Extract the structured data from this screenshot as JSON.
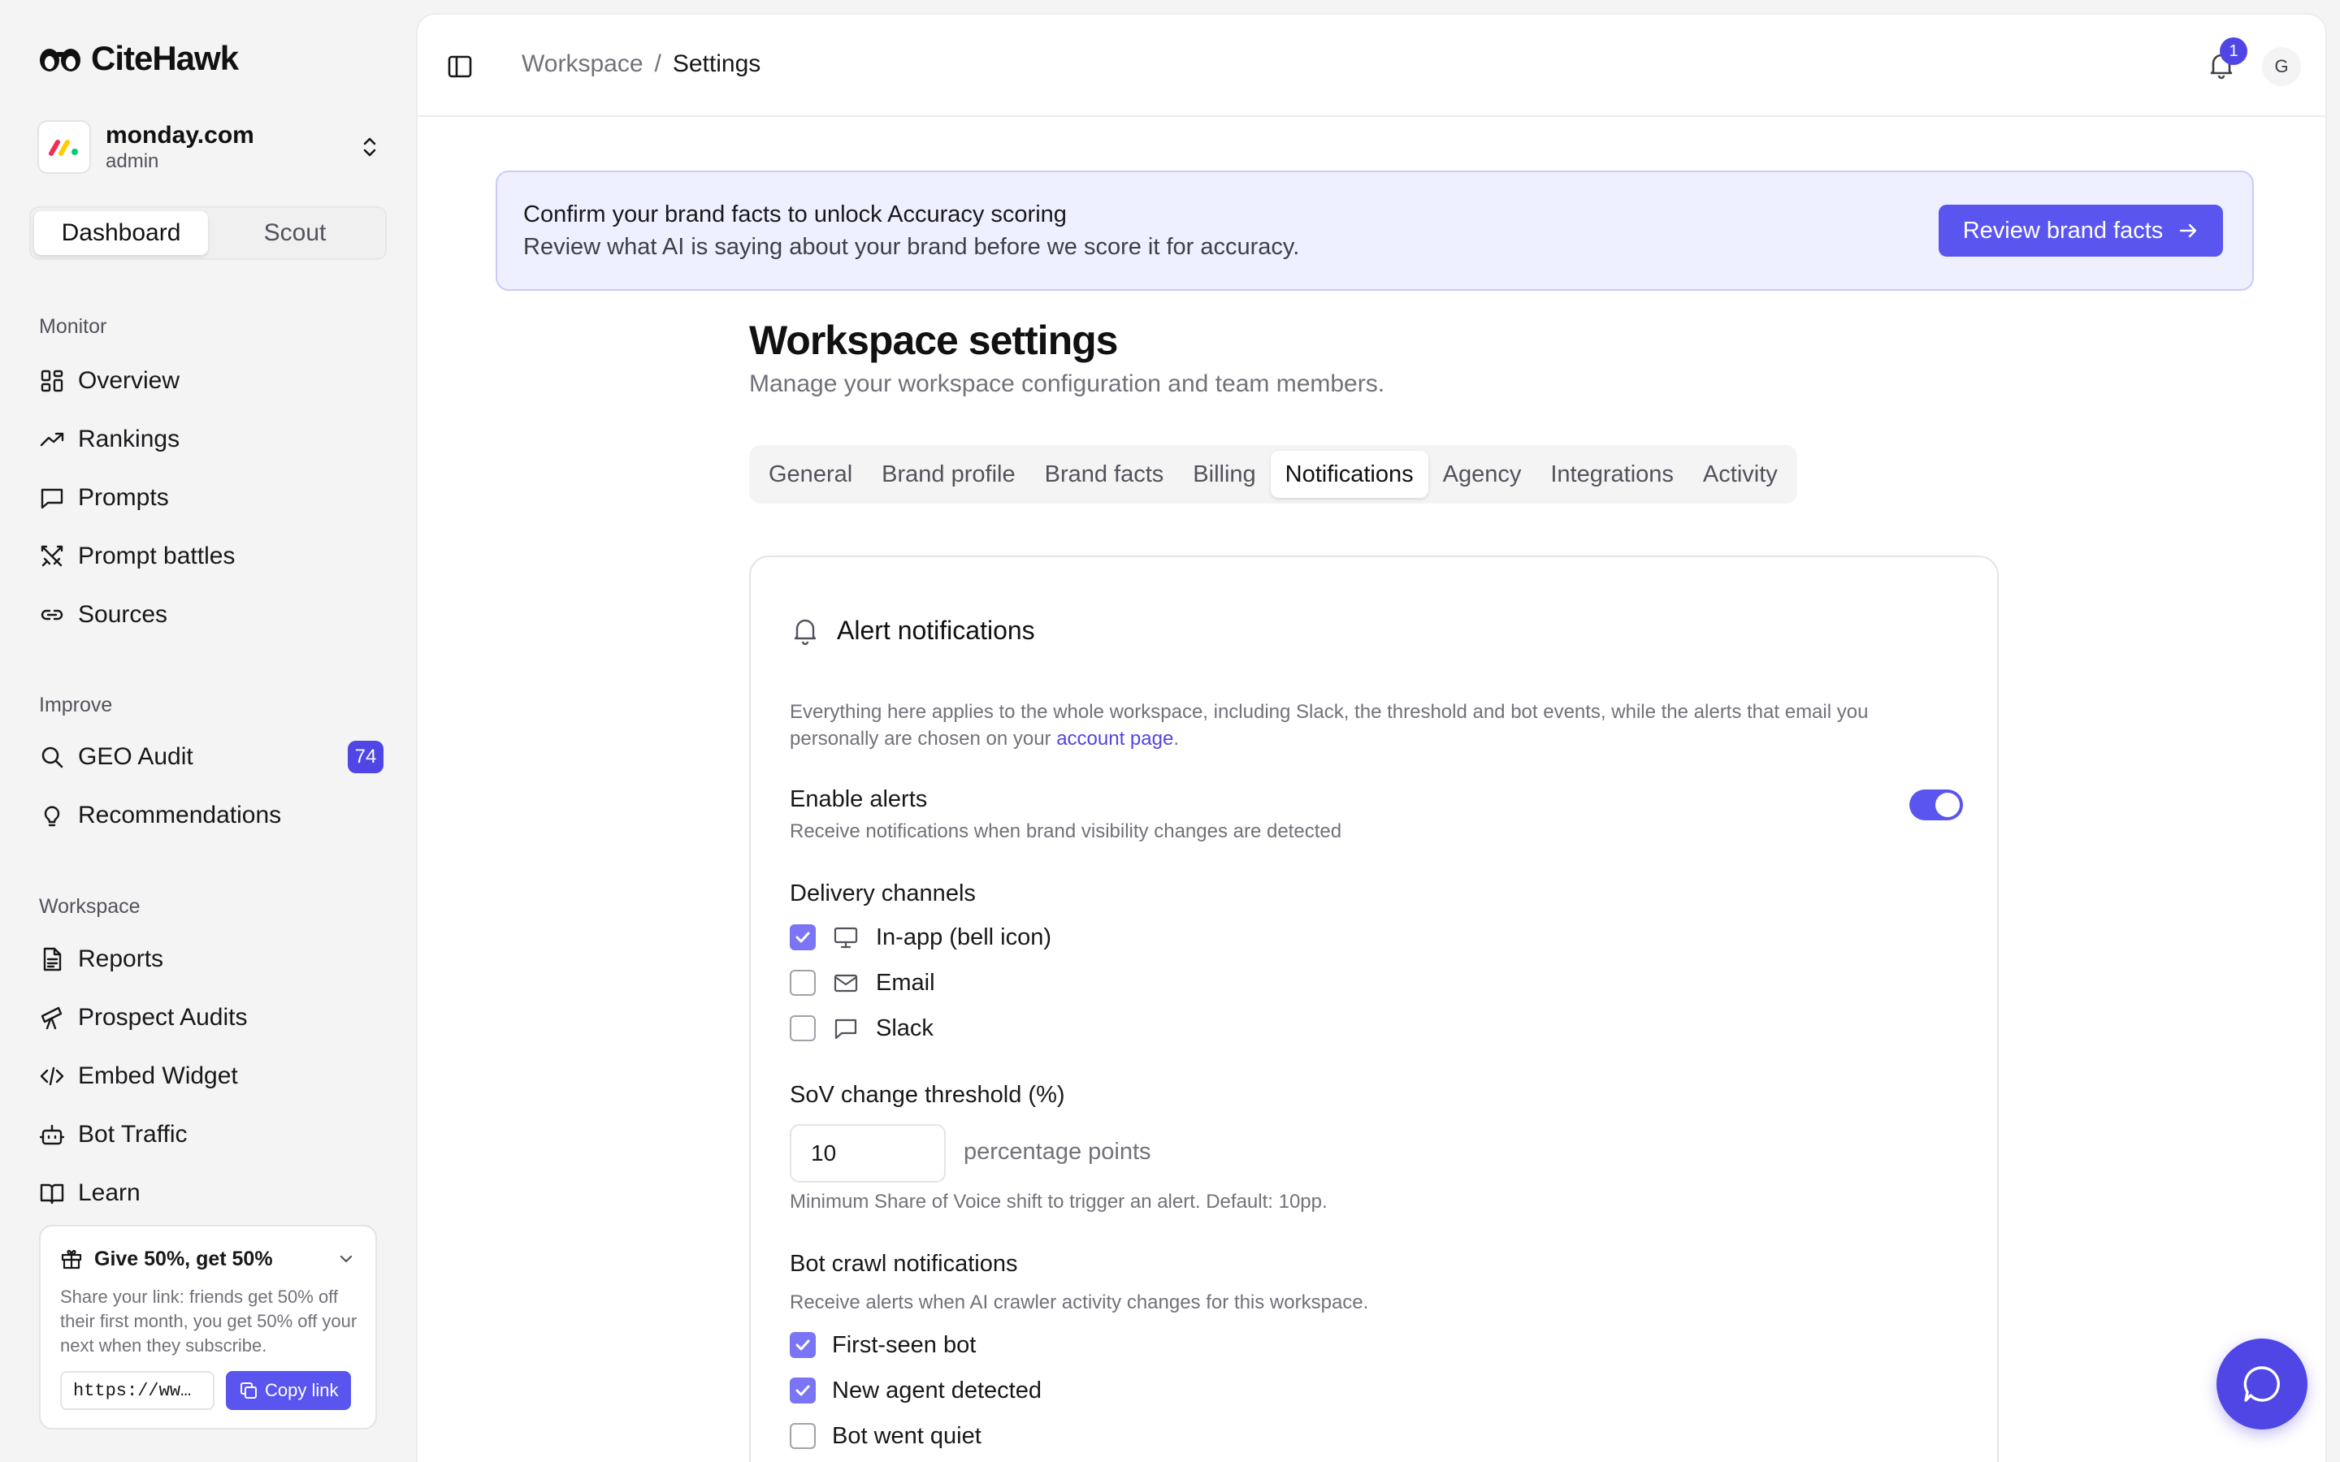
{
  "app": {
    "name": "CiteHawk"
  },
  "org": {
    "name": "monday.com",
    "role": "admin"
  },
  "mode_switch": {
    "active": "Dashboard",
    "other": "Scout"
  },
  "nav": {
    "monitor_label": "Monitor",
    "monitor": [
      "Overview",
      "Rankings",
      "Prompts",
      "Prompt battles",
      "Sources"
    ],
    "improve_label": "Improve",
    "improve": [
      {
        "label": "GEO Audit",
        "badge": "74"
      },
      {
        "label": "Recommendations"
      }
    ],
    "workspace_label": "Workspace",
    "workspace": [
      "Reports",
      "Prospect Audits",
      "Embed Widget",
      "Bot Traffic",
      "Learn"
    ]
  },
  "referral": {
    "title": "Give 50%, get 50%",
    "description": "Share your link: friends get 50% off their first month, you get 50% off your next when they subscribe.",
    "link": "https://ww…",
    "copy_label": "Copy link"
  },
  "topbar": {
    "breadcrumb": [
      "Workspace",
      "Settings"
    ],
    "separator": "/",
    "notification_count": "1",
    "avatar_initial": "G"
  },
  "banner": {
    "title": "Confirm your brand facts to unlock Accuracy scoring",
    "subtitle": "Review what AI is saying about your brand before we score it for accuracy.",
    "button": "Review brand facts"
  },
  "page": {
    "title": "Workspace settings",
    "subtitle": "Manage your workspace configuration and team members."
  },
  "tabs": {
    "items": [
      "General",
      "Brand profile",
      "Brand facts",
      "Billing",
      "Notifications",
      "Agency",
      "Integrations",
      "Activity"
    ],
    "active": "Notifications"
  },
  "alerts": {
    "title": "Alert notifications",
    "description_before": "Everything here applies to the whole workspace, including Slack, the threshold and bot events, while the alerts that email you personally are chosen on your ",
    "description_link": "account page",
    "description_after": ".",
    "enable": {
      "title": "Enable alerts",
      "subtitle": "Receive notifications when brand visibility changes are detected",
      "enabled": true
    },
    "channels": {
      "title": "Delivery channels",
      "items": [
        {
          "label": "In-app (bell icon)",
          "icon": "monitor-icon",
          "checked": true
        },
        {
          "label": "Email",
          "icon": "mail-icon",
          "checked": false
        },
        {
          "label": "Slack",
          "icon": "message-square-icon",
          "checked": false
        }
      ]
    },
    "threshold": {
      "title": "SoV change threshold (%)",
      "value": "10",
      "unit": "percentage points",
      "help": "Minimum Share of Voice shift to trigger an alert. Default: 10pp."
    },
    "bot": {
      "title": "Bot crawl notifications",
      "subtitle": "Receive alerts when AI crawler activity changes for this workspace.",
      "items": [
        {
          "label": "First-seen bot",
          "checked": true
        },
        {
          "label": "New agent detected",
          "checked": true
        },
        {
          "label": "Bot went quiet",
          "checked": false
        }
      ]
    }
  },
  "colors": {
    "accent": "#5b55f0",
    "badge": "#4f46e5",
    "banner_bg": "#eef0ff"
  }
}
